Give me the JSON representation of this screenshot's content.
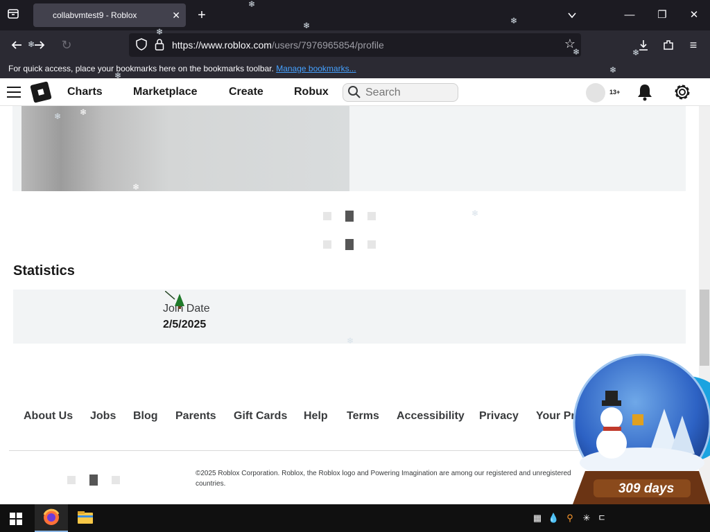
{
  "browser": {
    "tab_title": "collabvmtest9 - Roblox",
    "url_host": "https://www.roblox.com",
    "url_path": "/users/7976965854/profile",
    "bookmarks_hint": "For quick access, place your bookmarks here on the bookmarks toolbar.",
    "bookmarks_link": "Manage bookmarks..."
  },
  "header": {
    "nav": [
      "Charts",
      "Marketplace",
      "Create",
      "Robux"
    ],
    "search_placeholder": "Search",
    "age_badge": "13+"
  },
  "statistics": {
    "title": "Statistics",
    "join_date_label": "Join Date",
    "join_date_value": "2/5/2025"
  },
  "footer": {
    "links": [
      "About Us",
      "Jobs",
      "Blog",
      "Parents",
      "Gift Cards",
      "Help",
      "Terms",
      "Accessibility",
      "Privacy",
      "Your Pri"
    ],
    "copyright": "©2025 Roblox Corporation. Roblox, the Roblox logo and Powering Imagination are among our registered and unregistered countries."
  },
  "overlay": {
    "days_counter": "309 days"
  },
  "colors": {
    "browser_dark": "#1c1b22",
    "browser_toolbar": "#2b2a33",
    "link_blue": "#45a1ff",
    "roblox_text": "#191919",
    "panel_grey": "#f2f4f5"
  },
  "icons": [
    "tab-list-icon",
    "close-icon",
    "plus-icon",
    "chevron-down-icon",
    "minimize-icon",
    "maximize-icon",
    "back-arrow-icon",
    "forward-arrow-icon",
    "reload-icon",
    "shield-icon",
    "lock-icon",
    "star-icon",
    "download-icon",
    "extensions-icon",
    "menu-icon",
    "hamburger-icon",
    "roblox-logo",
    "search-icon",
    "bell-icon",
    "gear-icon",
    "windows-start-icon",
    "firefox-icon",
    "file-explorer-icon"
  ]
}
